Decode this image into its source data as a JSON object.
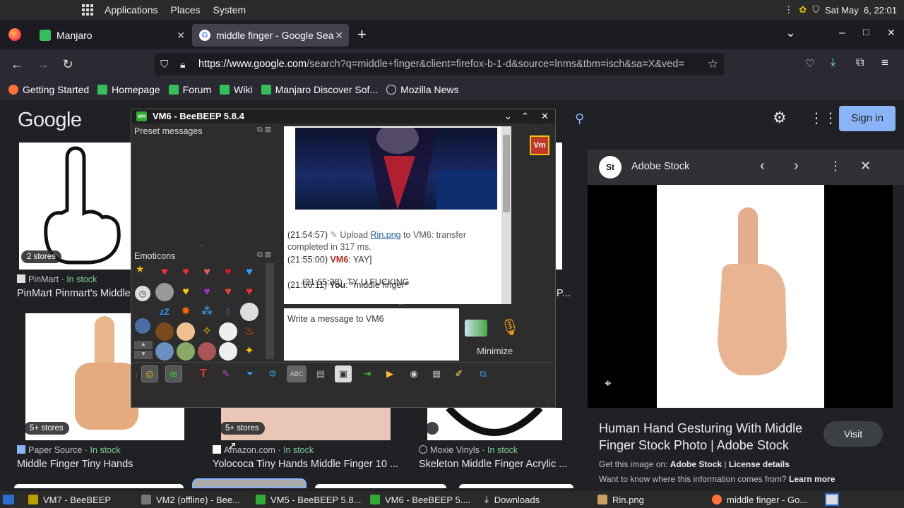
{
  "top_panel": {
    "menus": [
      "Applications",
      "Places",
      "System"
    ],
    "clock": "Sat May  6, 22:01"
  },
  "tabs": [
    {
      "label": "Manjaro",
      "close": "✕"
    },
    {
      "label": "middle finger - Google Sea",
      "close": "✕"
    }
  ],
  "new_tab": "+",
  "window_controls": {
    "min": "–",
    "max": "□",
    "close": "✕",
    "list": "⌄"
  },
  "nav": {
    "back": "←",
    "forward": "→",
    "reload": "↻",
    "url_domain": "https://www.google.com",
    "url_rest": "/search?q=middle+finger&client=firefox-b-1-d&source=lnms&tbm=isch&sa=X&ved="
  },
  "bookmarks": [
    "Getting Started",
    "Homepage",
    "Forum",
    "Wiki",
    "Manjaro Discover Sof...",
    "Mozilla News"
  ],
  "google": {
    "logo": "Google",
    "sign_in": "Sign in",
    "results": [
      {
        "badge": "2 stores",
        "source": "PinMart",
        "stock": "In stock",
        "title": "PinMart Pinmart's Middle"
      },
      {
        "badge": "5+ stores",
        "source": "Paper Source",
        "stock": "In stock",
        "title": "Middle Finger Tiny Hands"
      },
      {
        "badge": "5+ stores",
        "source": "Amazon.com",
        "stock": "In stock",
        "title": "Yolococa Tiny Hands Middle Finger 10 ..."
      },
      {
        "badge": "",
        "source": "Moxie Vinyls",
        "stock": "In stock",
        "title": "Skeleton Middle Finger Acrylic ..."
      }
    ],
    "partial_p": "P..."
  },
  "side_panel": {
    "source_name": "Adobe Stock",
    "source_logo": "St",
    "title_line1": "Human Hand Gesturing With Middle",
    "title_line2": "Finger Stock Photo | Adobe Stock",
    "visit": "Visit",
    "get_image_on": "Get this image on:",
    "get_image_source": "Adobe Stock",
    "license": "License details",
    "want_to_know": "Want to know where this information comes from?",
    "learn_more": "Learn more"
  },
  "beebeep": {
    "title": "VM6 - BeeBEEP 5.8.4",
    "preset_messages": "Preset messages",
    "emoticons": "Emoticons",
    "avatar": "Vm",
    "chat": [
      {
        "time": "(21:54:57)",
        "text": " Upload ",
        "link": "Rin.png",
        "after": " to VM6: transfer"
      },
      {
        "time": "",
        "text": "completed in 317 ms.",
        "link": "",
        "after": ""
      },
      {
        "time": "(21:55:00)",
        "user": "VM6",
        "text": ": YAY]"
      },
      {
        "time": "(21:55:38)",
        "user": "",
        "text": "  TY U FUCKING"
      },
      {
        "time": "(21:56:11)",
        "user": "You",
        "text": ": *middle finger*"
      }
    ],
    "input_placeholder": "Write a message to VM6",
    "minimize": "Minimize"
  },
  "taskbar": [
    "VM7 - BeeBEEP",
    "VM2 (offline) - Bee...",
    "VM5 - BeeBEEP 5.8...",
    "VM6 - BeeBEEP 5....",
    "Downloads",
    "Rin.png",
    "middle finger - Go..."
  ],
  "colors": {
    "firefox_dark": "#1c1b22",
    "google_blue": "#8ab4f8",
    "in_stock_green": "#81c995",
    "bee_accent": "#e8a200"
  }
}
